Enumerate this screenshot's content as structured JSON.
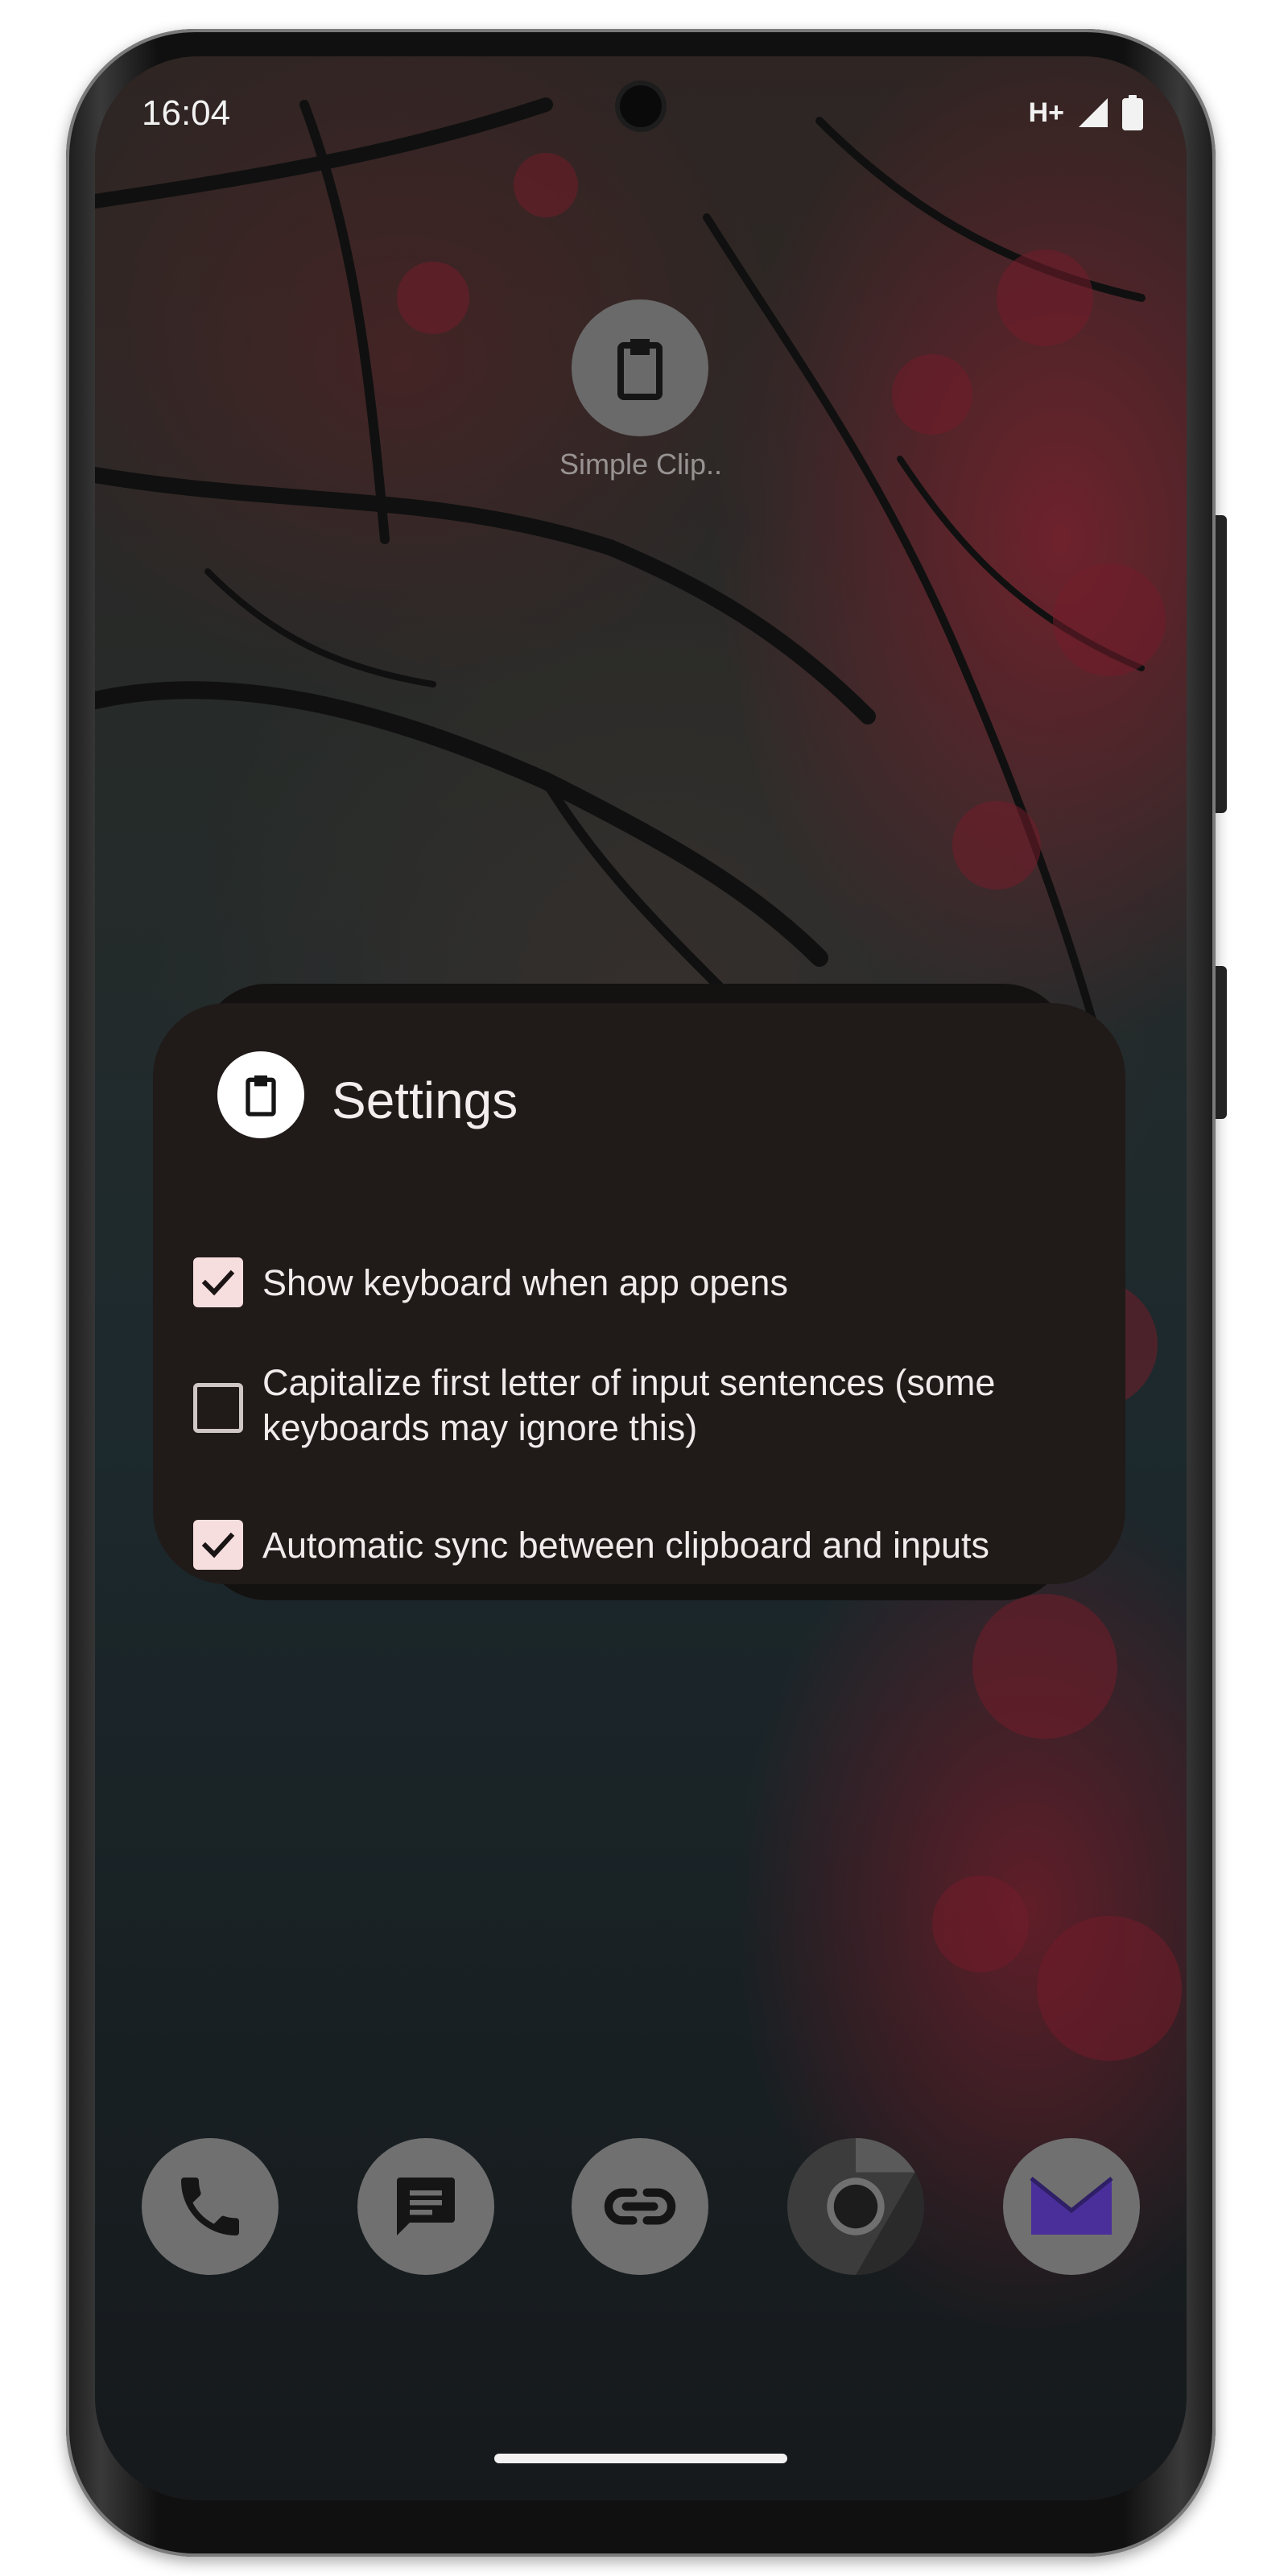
{
  "status_bar": {
    "time": "16:04",
    "network": "H+",
    "icons": [
      "network-type-icon",
      "signal-icon",
      "battery-icon"
    ]
  },
  "home": {
    "app_shortcut": {
      "icon": "clipboard-icon",
      "label": "Simple Clip.."
    }
  },
  "widget": {
    "icon": "clipboard-icon",
    "title": "Settings",
    "options": [
      {
        "label": "Show keyboard when app opens",
        "checked": true
      },
      {
        "label": "Capitalize first letter of input sentences (some keyboards may ignore this)",
        "checked": false
      },
      {
        "label": "Automatic sync between clipboard and inputs",
        "checked": true
      }
    ]
  },
  "dock": [
    {
      "icon": "phone-icon"
    },
    {
      "icon": "messages-icon"
    },
    {
      "icon": "link-icon"
    },
    {
      "icon": "chrome-icon"
    },
    {
      "icon": "mail-icon"
    }
  ],
  "colors": {
    "widget_background": "#201a19",
    "checkbox_fill": "#f7dede",
    "text": "#f1ecec",
    "dock_icon_background": "#707070",
    "mail_accent": "#4a2f9a"
  }
}
